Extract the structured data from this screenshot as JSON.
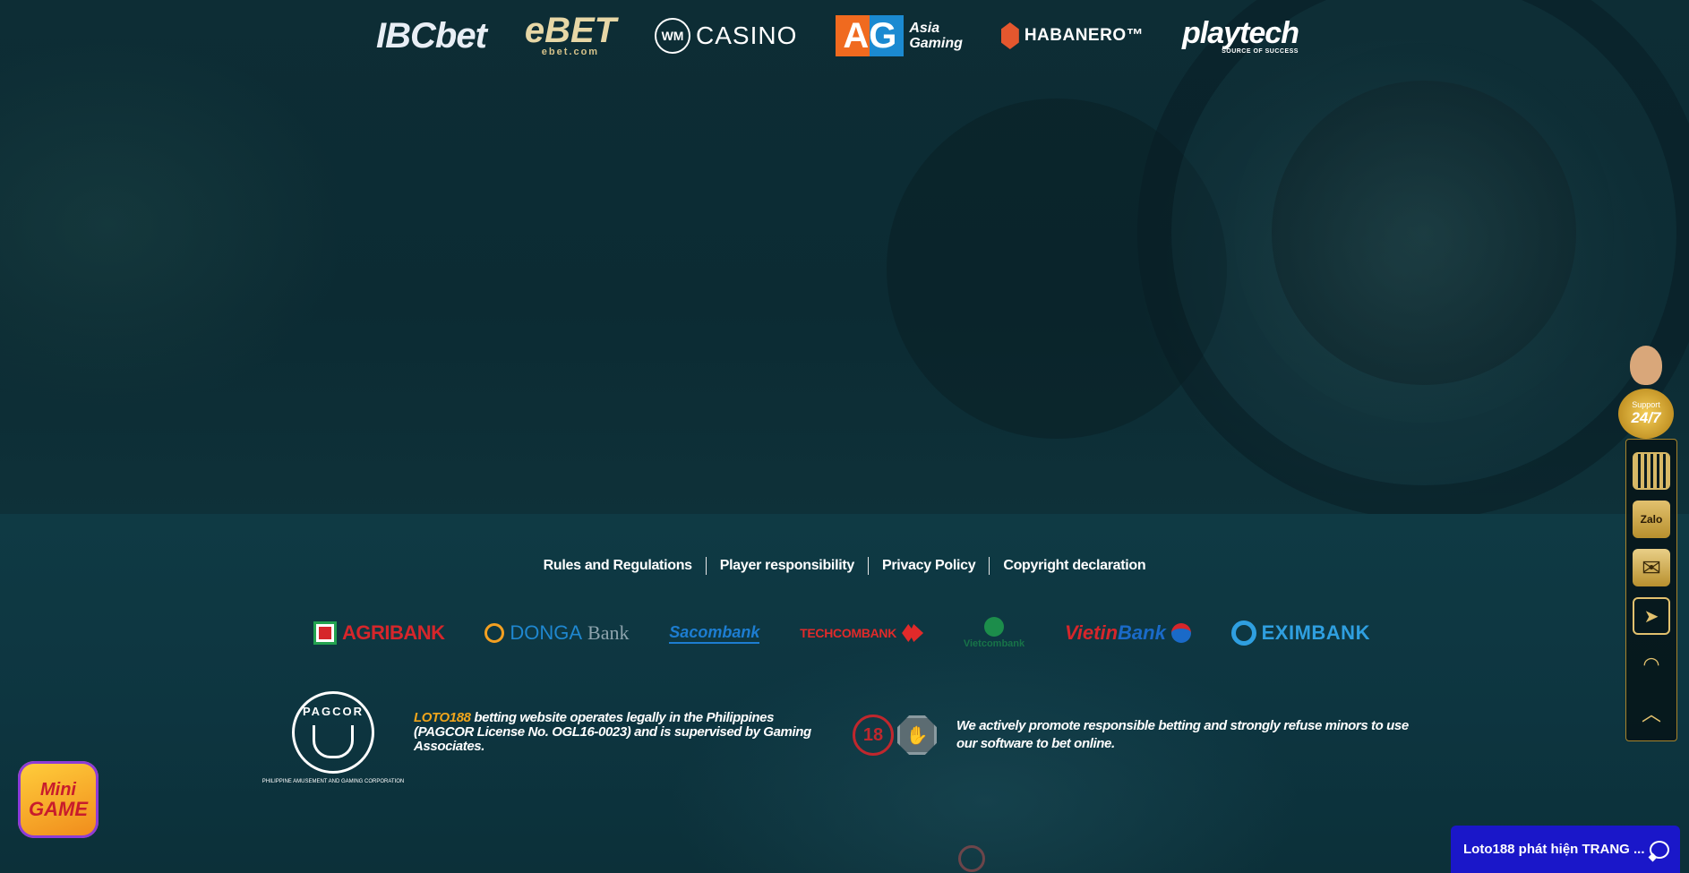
{
  "providers": [
    {
      "id": "ibcbet",
      "text": "IBCbet"
    },
    {
      "id": "ebet",
      "text": "eBET",
      "sub": "ebet.com"
    },
    {
      "id": "wm",
      "mark": "WM",
      "text": "CASINO"
    },
    {
      "id": "ag",
      "mark": "AG",
      "line1": "Asia",
      "line2": "Gaming"
    },
    {
      "id": "habanero",
      "text": "HABANERO™"
    },
    {
      "id": "playtech",
      "text": "playtech",
      "sub": "SOURCE OF SUCCESS"
    }
  ],
  "footer_links": [
    {
      "label": "Rules and Regulations"
    },
    {
      "label": "Player responsibility"
    },
    {
      "label": "Privacy Policy"
    },
    {
      "label": "Copyright declaration"
    }
  ],
  "banks": {
    "agribank": "AGRIBANK",
    "donga_a": "DONGA",
    "donga_b": "Bank",
    "sacombank": "Sacombank",
    "techcombank": "TECHCOMBANK",
    "vietcombank": "Vietcombank",
    "vietin_a": "Vietin",
    "vietin_b": "Bank",
    "eximbank": "EXIMBANK"
  },
  "license": {
    "pagcor": "PAGCOR",
    "pagcor_caption": "PHILIPPINE AMUSEMENT AND GAMING CORPORATION",
    "brand": "LOTO188",
    "text": " betting website operates legally in the Philippines (PAGCOR License No. OGL16-0023) and is supervised by Gaming Associates."
  },
  "responsible": {
    "age": "18",
    "text": "We actively promote responsible betting and strongly refuse minors to use our software to bet online."
  },
  "support": {
    "label": "Support",
    "hours": "24/7",
    "zalo": "Zalo"
  },
  "minigame": {
    "line1": "Mini",
    "line2": "GAME"
  },
  "chat": {
    "text": "Loto188 phát hiện TRANG ..."
  },
  "colors": {
    "brand": "#f0a51c",
    "chat_bar": "#1a17c9",
    "footer_bg": "#0f3a44"
  }
}
